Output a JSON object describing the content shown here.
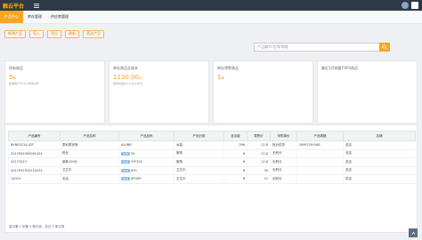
{
  "app": {
    "title": "触云平台"
  },
  "nav": {
    "items": [
      "产品中心",
      "库存管理",
      "供应商管理"
    ]
  },
  "toolbar": {
    "tabs": [
      "新增产品",
      "导入",
      "导出",
      "刷新",
      "筛选产品"
    ],
    "search_placeholder": "产品编号/名称/规格"
  },
  "stats": [
    {
      "title": "所有商品",
      "value": "5",
      "unit": "种",
      "note": "数据统计于2019年的3月"
    },
    {
      "title": "库存商品总成本",
      "value": "1130.00",
      "unit": "元",
      "note": "所有商品共1,128,208元"
    },
    {
      "title": "库存预警商品",
      "value": "1",
      "unit": "种",
      "note": ""
    },
    {
      "title": "最近1月销量TOP3商品",
      "value": "",
      "unit": "",
      "note": ""
    }
  ],
  "table": {
    "headers": [
      "产品编号",
      "产品名称",
      "产品品码",
      "产品分类",
      "含功能",
      "零售价",
      "采购单价",
      "产品规格",
      "店铺"
    ],
    "rows": [
      {
        "code": "BVN05214-02F",
        "name": "泰利泰安锋",
        "badge": "",
        "sku": "ALUNR",
        "category": "女装",
        "qty": "296",
        "price": "12.8",
        "cost": "批价供货",
        "spec": "286*130*268",
        "store": "总店"
      },
      {
        "code": "2017091905061424",
        "name": "粉丝",
        "badge": "促销",
        "sku": "99",
        "category": "服饰",
        "qty": "8",
        "price": "21.8",
        "cost": "无积分",
        "spec": "",
        "store": "总店"
      },
      {
        "code": "20171013",
        "name": "新款100片",
        "badge": "热卖",
        "sku": "YYF20C",
        "category": "服饰",
        "qty": "8",
        "price": "11.8",
        "cost": "无积分",
        "spec": "",
        "store": "总店"
      },
      {
        "code": "2017091910110224",
        "name": "卫生巾",
        "badge": "热卖",
        "sku": "6Y0",
        "category": "卫生巾",
        "qty": "8",
        "price": "30",
        "cost": "无积分",
        "spec": "",
        "store": "总店"
      },
      {
        "code": "14024",
        "name": "毛毛",
        "badge": "热卖",
        "sku": "XFGBY",
        "category": "卫生巾",
        "qty": "8",
        "price": "12",
        "cost": "无积分",
        "spec": "",
        "store": "总店"
      }
    ]
  },
  "footer": "显示第 1 到第 5 条记录，总共 5 条记录"
}
